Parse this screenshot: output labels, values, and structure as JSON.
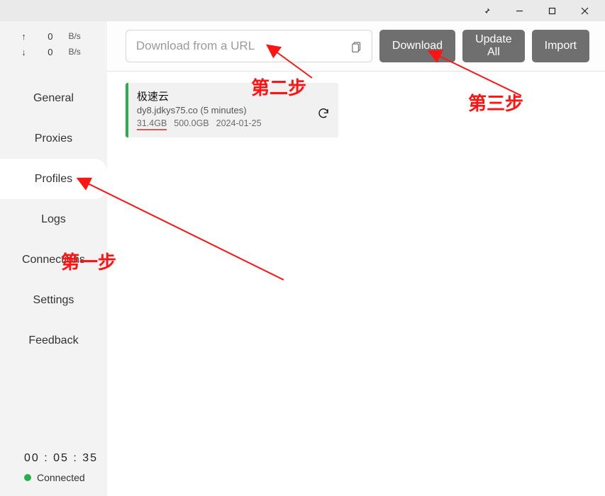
{
  "titlebar": {
    "pin": "📌",
    "minimize": "—",
    "maximize": "▢",
    "close": "✕"
  },
  "speed": {
    "up_arrow": "↑",
    "up_value": "0",
    "up_unit": "B/s",
    "down_arrow": "↓",
    "down_value": "0",
    "down_unit": "B/s"
  },
  "nav": {
    "general": "General",
    "proxies": "Proxies",
    "profiles": "Profiles",
    "logs": "Logs",
    "connections": "Connections",
    "settings": "Settings",
    "feedback": "Feedback"
  },
  "footer": {
    "timer": "00 : 05 : 35",
    "status": "Connected"
  },
  "toolbar": {
    "url_placeholder": "Download from a URL",
    "download": "Download",
    "update_all": "Update All",
    "import": "Import"
  },
  "profile": {
    "title": "极速云",
    "subtitle": "dy8.jdkys75.co (5 minutes)",
    "used": "31.4GB",
    "total": "500.0GB",
    "date": "2024-01-25"
  },
  "annotations": {
    "step1": "第一步",
    "step2": "第二步",
    "step3": "第三步"
  }
}
